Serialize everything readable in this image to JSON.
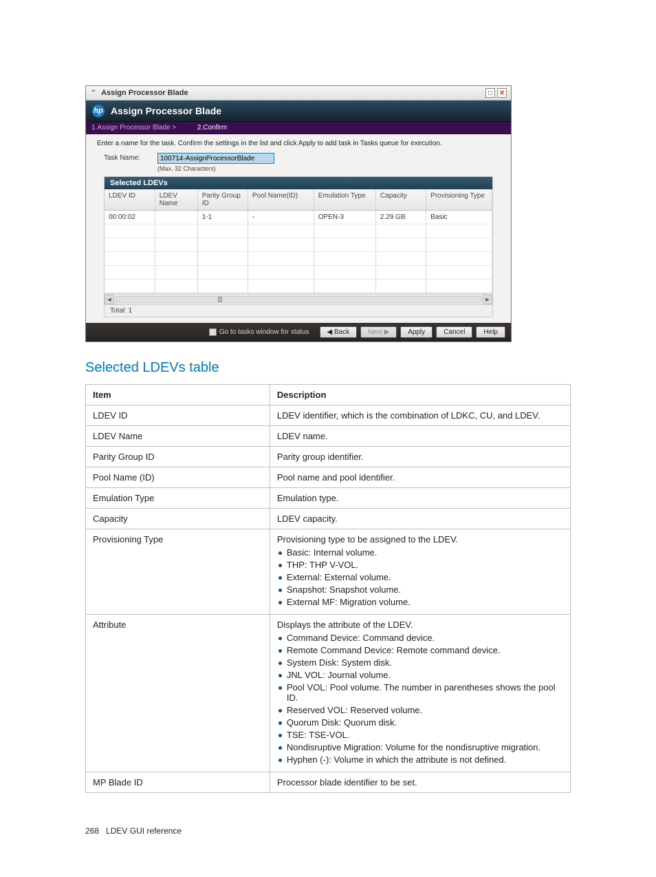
{
  "dialog": {
    "window_title": "Assign Processor Blade",
    "header_title": "Assign Processor Blade",
    "steps": {
      "step1": "1.Assign Processor Blade >",
      "step2": "2.Confirm"
    },
    "instruction": "Enter a name for the task. Confirm the settings in the list and click Apply to add task in Tasks queue for execution.",
    "task_label": "Task Name:",
    "task_value": "100714-AssignProcessorBlade",
    "task_hint": "(Max. 32 Characters)",
    "grid_title": "Selected LDEVs",
    "cols": {
      "c0": "LDEV ID",
      "c1": "LDEV Name",
      "c2": "Parity Group ID",
      "c3": "Pool Name(ID)",
      "c4": "Emulation Type",
      "c5": "Capacity",
      "c6": "Provisioning Type"
    },
    "row": {
      "c0": "00:00:02",
      "c1": "",
      "c2": "1-1",
      "c3": "-",
      "c4": "OPEN-3",
      "c5": "2.29 GB",
      "c6": "Basic"
    },
    "total": "Total: 1",
    "buttons": {
      "tasks": "Go to tasks window for status",
      "back": "◀ Back",
      "next": "Next ▶",
      "apply": "Apply",
      "cancel": "Cancel",
      "help": "Help"
    }
  },
  "section_title": "Selected LDEVs table",
  "th_item": "Item",
  "th_desc": "Description",
  "rows": {
    "r1": {
      "item": "LDEV ID",
      "desc": "LDEV identifier, which is the combination of LDKC, CU, and LDEV."
    },
    "r2": {
      "item": "LDEV Name",
      "desc": "LDEV name."
    },
    "r3": {
      "item": "Parity Group ID",
      "desc": "Parity group identifier."
    },
    "r4": {
      "item": "Pool Name (ID)",
      "desc": "Pool name and pool identifier."
    },
    "r5": {
      "item": "Emulation Type",
      "desc": "Emulation type."
    },
    "r6": {
      "item": "Capacity",
      "desc": "LDEV capacity."
    },
    "r7": {
      "item": "Provisioning Type",
      "desc": "Provisioning type to be assigned to the LDEV.",
      "b1": "Basic: Internal volume.",
      "b2": "THP: THP V-VOL.",
      "b3": "External: External volume.",
      "b4": "Snapshot: Snapshot volume.",
      "b5": "External MF: Migration volume."
    },
    "r8": {
      "item": "Attribute",
      "desc": "Displays the attribute of the LDEV.",
      "b1": "Command Device: Command device.",
      "b2": "Remote Command Device: Remote command device.",
      "b3": "System Disk: System disk.",
      "b4": "JNL VOL: Journal volume.",
      "b5": "Pool VOL: Pool volume. The number in parentheses shows the pool ID.",
      "b6": "Reserved VOL: Reserved volume.",
      "b7": "Quorum Disk: Quorum disk.",
      "b8": "TSE: TSE-VOL.",
      "b9": "Nondisruptive Migration: Volume for the nondisruptive migration.",
      "b10": "Hyphen (-): Volume in which the attribute is not defined."
    },
    "r9": {
      "item": "MP Blade ID",
      "desc": "Processor blade identifier to be set."
    }
  },
  "footer": {
    "pagenum": "268",
    "section": "LDEV GUI reference"
  }
}
